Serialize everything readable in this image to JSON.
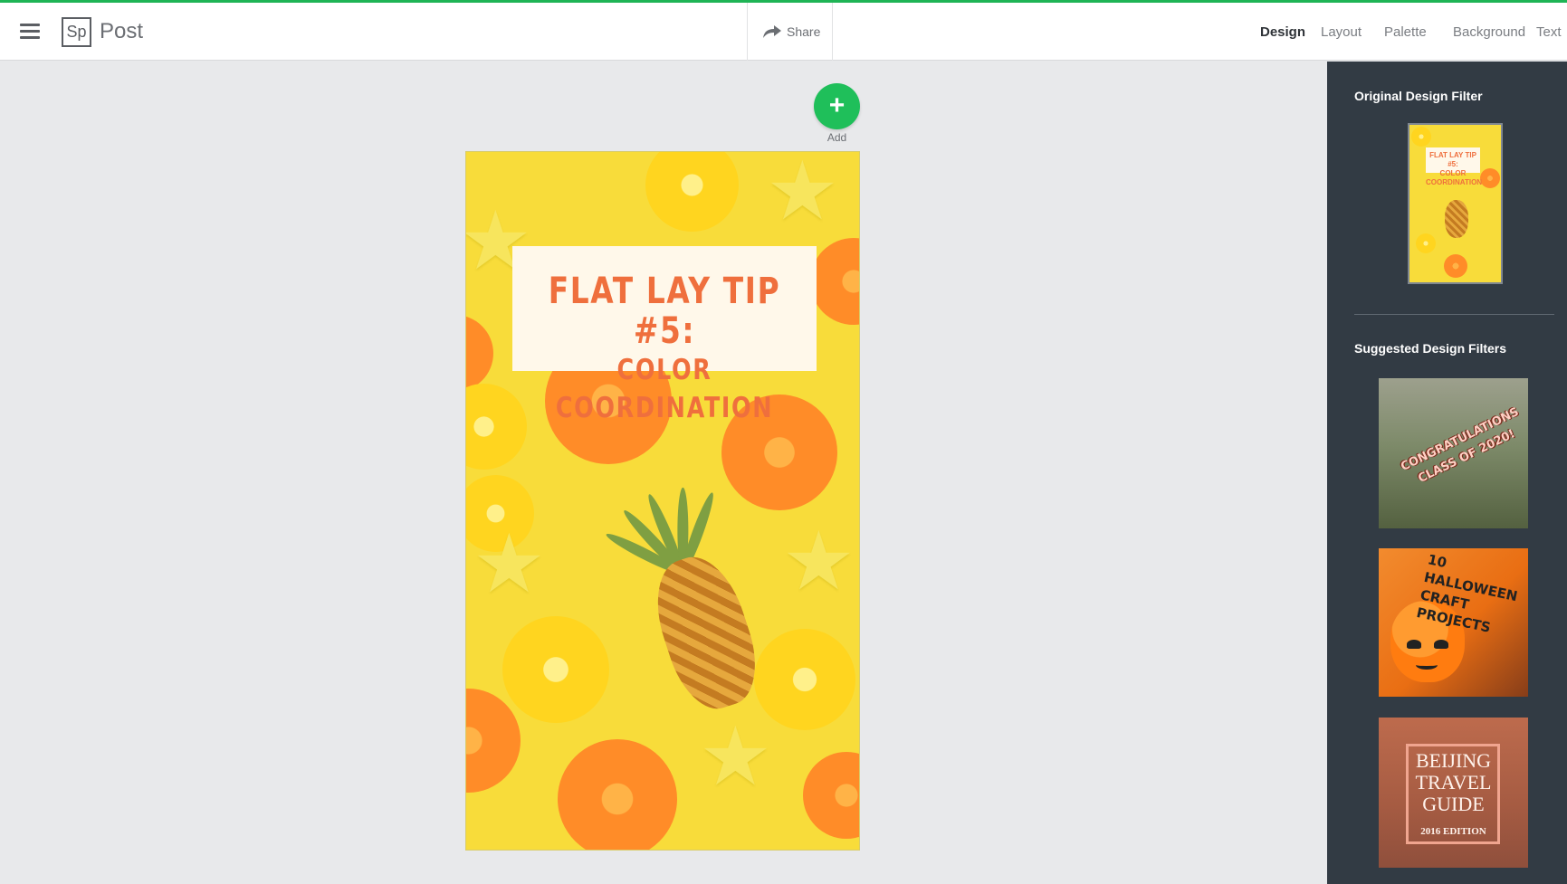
{
  "app": {
    "logo_text": "Sp",
    "name": "Post"
  },
  "header": {
    "share_label": "Share",
    "tabs": [
      {
        "label": "Design",
        "active": true
      },
      {
        "label": "Layout",
        "active": false
      },
      {
        "label": "Palette",
        "active": false
      },
      {
        "label": "Background",
        "active": false
      },
      {
        "label": "Text",
        "active": false
      }
    ]
  },
  "canvas": {
    "add_label": "Add",
    "title_line_1": "FLAT LAY TIP #5:",
    "title_line_2": "COLOR COORDINATION"
  },
  "sidebar": {
    "original_heading": "Original Design Filter",
    "suggested_heading": "Suggested Design Filters",
    "original_thumb_title_1": "FLAT LAY TIP #5:",
    "original_thumb_title_2": "COLOR COORDINATION",
    "suggestions": [
      {
        "line_1": "CONGRATULATIONS",
        "line_2": "CLASS OF 2020!"
      },
      {
        "line_1": "10 HALLOWEEN",
        "line_2": "CRAFT PROJECTS"
      },
      {
        "line_1": "BEIJING",
        "line_2": "TRAVEL",
        "line_3": "GUIDE",
        "line_4": "2016 EDITION"
      }
    ]
  },
  "icons": [
    "menu-icon",
    "share-icon",
    "plus-icon"
  ],
  "colors": {
    "accent_green": "#1fbf5a",
    "sidebar_bg": "#323b44",
    "title_orange": "#ef6f3d"
  }
}
